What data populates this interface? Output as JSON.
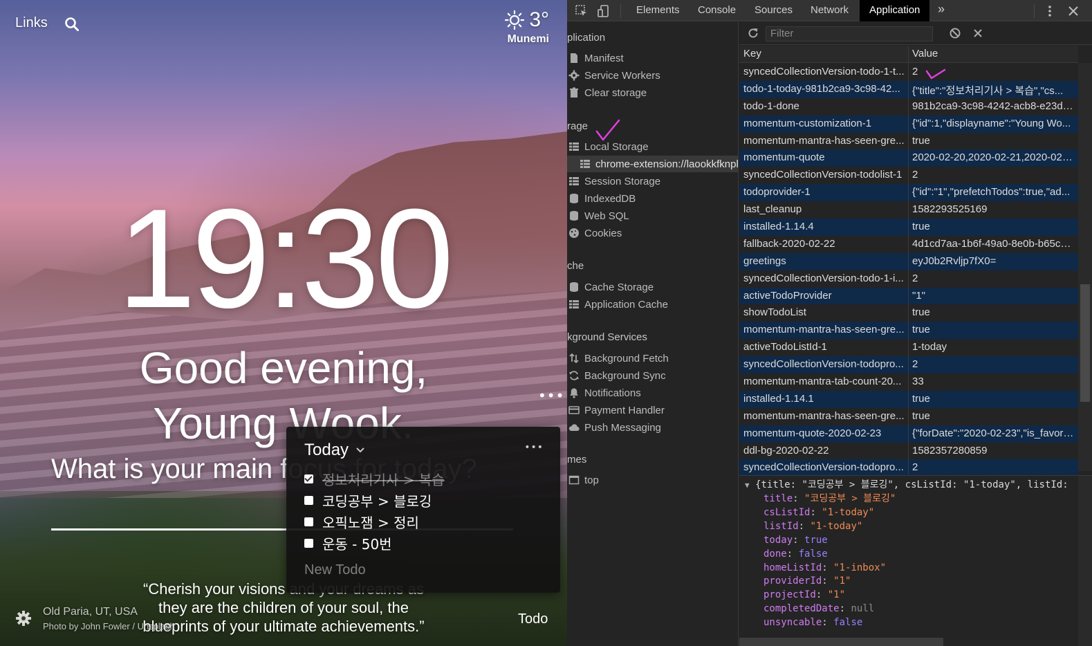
{
  "momentum": {
    "links_label": "Links",
    "weather": {
      "temp": "3°",
      "location": "Munemi"
    },
    "time": "19:30",
    "greeting_line1": "Good evening,",
    "greeting_line2": "Young Wook.",
    "focus_prompt": "What is your main focus for today?",
    "quote": "“Cherish your visions and your dreams as they are the children of your soul, the blueprints of your ultimate achievements.”",
    "photo_location": "Old Paria, UT, USA",
    "photo_credit": "Photo by John Fowler / Unsplash",
    "todo_button": "Todo",
    "todo_panel": {
      "title": "Today",
      "items": [
        {
          "text": "정보처리기사 > 복습",
          "done": true
        },
        {
          "text": "코딩공부 > 블로깅",
          "done": false
        },
        {
          "text": "오픽노잼 > 정리",
          "done": false
        },
        {
          "text": "운동 - 50번",
          "done": false
        }
      ],
      "new_placeholder": "New Todo"
    }
  },
  "devtools": {
    "tabs": [
      "Elements",
      "Console",
      "Sources",
      "Network",
      "Application"
    ],
    "active_tab": "Application",
    "sidebar": {
      "sections": {
        "application": "plication",
        "storage": "rage",
        "cache": "che",
        "background": "kground Services",
        "frames": "mes"
      },
      "application_items": [
        "Manifest",
        "Service Workers",
        "Clear storage"
      ],
      "storage_items": [
        "Local Storage",
        "chrome-extension://laookkfknpl",
        "Session Storage",
        "IndexedDB",
        "Web SQL",
        "Cookies"
      ],
      "cache_items": [
        "Cache Storage",
        "Application Cache"
      ],
      "background_items": [
        "Background Fetch",
        "Background Sync",
        "Notifications",
        "Payment Handler",
        "Push Messaging"
      ],
      "frames_items": [
        "top"
      ]
    },
    "filter_placeholder": "Filter",
    "table": {
      "headers": {
        "key": "Key",
        "value": "Value"
      },
      "rows": [
        {
          "key": "syncedCollectionVersion-todo-1-t...",
          "value": "2"
        },
        {
          "key": "todo-1-today-981b2ca9-3c98-42...",
          "value": "{\"title\":\"정보처리기사 > 복습\",\"cs..."
        },
        {
          "key": "todo-1-done",
          "value": "981b2ca9-3c98-4242-acb8-e23dc..."
        },
        {
          "key": "momentum-customization-1",
          "value": "{\"id\":1,\"displayname\":\"Young Wo..."
        },
        {
          "key": "momentum-mantra-has-seen-gre...",
          "value": "true"
        },
        {
          "key": "momentum-quote",
          "value": "2020-02-20,2020-02-21,2020-02-..."
        },
        {
          "key": "syncedCollectionVersion-todolist-1",
          "value": "2"
        },
        {
          "key": "todoprovider-1",
          "value": "{\"id\":\"1\",\"prefetchTodos\":true,\"ad..."
        },
        {
          "key": "last_cleanup",
          "value": "1582293525169"
        },
        {
          "key": "installed-1.14.4",
          "value": "true"
        },
        {
          "key": "fallback-2020-02-22",
          "value": "4d1cd7aa-1b6f-49a0-8e0b-b65c7..."
        },
        {
          "key": "greetings",
          "value": "eyJ0b2Rvljp7fX0="
        },
        {
          "key": "syncedCollectionVersion-todo-1-i...",
          "value": "2"
        },
        {
          "key": "activeTodoProvider",
          "value": "\"1\""
        },
        {
          "key": "showTodoList",
          "value": "true"
        },
        {
          "key": "momentum-mantra-has-seen-gre...",
          "value": "true"
        },
        {
          "key": "activeTodoListId-1",
          "value": "1-today"
        },
        {
          "key": "syncedCollectionVersion-todopro...",
          "value": "2"
        },
        {
          "key": "momentum-mantra-tab-count-20...",
          "value": "33"
        },
        {
          "key": "installed-1.14.1",
          "value": "true"
        },
        {
          "key": "momentum-mantra-has-seen-gre...",
          "value": "true"
        },
        {
          "key": "momentum-quote-2020-02-23",
          "value": "{\"forDate\":\"2020-02-23\",\"is_favori..."
        },
        {
          "key": "ddl-bg-2020-02-22",
          "value": "1582357280859"
        },
        {
          "key": "syncedCollectionVersion-todopro...",
          "value": "2"
        }
      ]
    },
    "preview": {
      "summary": "{title: \"코딩공부 > 블로깅\", csListId: \"1-today\", listId:",
      "props": [
        {
          "key": "title",
          "value": "\"코딩공부 > 블로깅\"",
          "kind": "str"
        },
        {
          "key": "csListId",
          "value": "\"1-today\"",
          "kind": "str"
        },
        {
          "key": "listId",
          "value": "\"1-today\"",
          "kind": "str"
        },
        {
          "key": "today",
          "value": "true",
          "kind": "bool"
        },
        {
          "key": "done",
          "value": "false",
          "kind": "bool"
        },
        {
          "key": "homeListId",
          "value": "\"1-inbox\"",
          "kind": "str"
        },
        {
          "key": "providerId",
          "value": "\"1\"",
          "kind": "str"
        },
        {
          "key": "projectId",
          "value": "\"1\"",
          "kind": "str"
        },
        {
          "key": "completedDate",
          "value": "null",
          "kind": "null"
        },
        {
          "key": "unsyncable",
          "value": "false",
          "kind": "bool"
        }
      ]
    }
  },
  "colors": {
    "accent_active_tab": "#000000",
    "row_alt": "#0f2949",
    "annotation_pink": "#e040e0"
  }
}
